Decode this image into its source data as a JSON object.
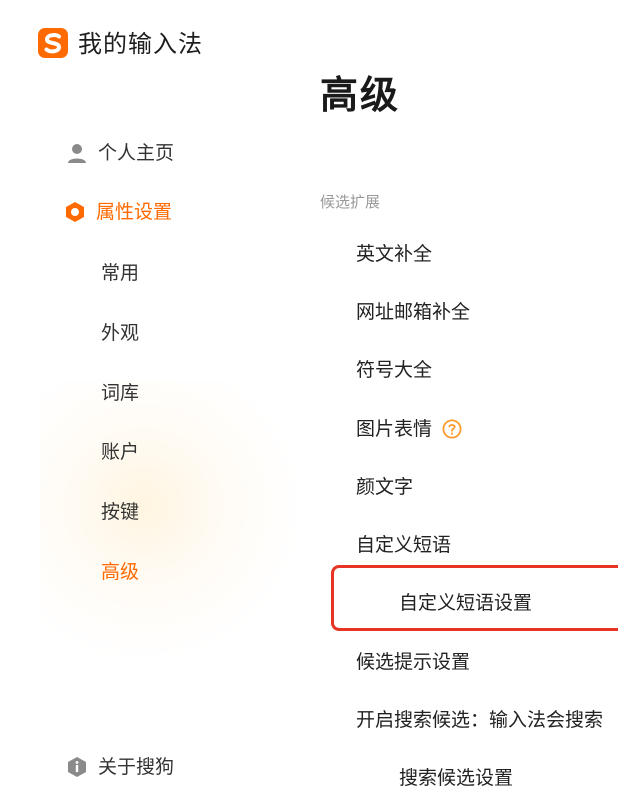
{
  "app": {
    "title": "我的输入法",
    "logo_icon": "sogou-s-logo",
    "brand_color": "#ff6a00"
  },
  "page": {
    "title": "高级"
  },
  "sidebar": {
    "profile_label": "个人主页",
    "settings_label": "属性设置",
    "sub_items": [
      {
        "label": "常用",
        "active": false
      },
      {
        "label": "外观",
        "active": false
      },
      {
        "label": "词库",
        "active": false
      },
      {
        "label": "账户",
        "active": false
      },
      {
        "label": "按键",
        "active": false
      },
      {
        "label": "高级",
        "active": true
      }
    ],
    "about_label": "关于搜狗"
  },
  "content": {
    "section_label": "候选扩展",
    "rows": [
      {
        "label": "英文补全"
      },
      {
        "label": "网址邮箱补全"
      },
      {
        "label": "符号大全"
      },
      {
        "label": "图片表情",
        "has_help_icon": true
      },
      {
        "label": "颜文字"
      },
      {
        "label": "自定义短语"
      },
      {
        "label": "自定义短语设置",
        "highlighted": true
      },
      {
        "label": "候选提示设置"
      },
      {
        "label": "开启搜索候选：输入法会搜索"
      },
      {
        "label": "搜索候选设置"
      }
    ],
    "highlight_color": "#e83424"
  }
}
